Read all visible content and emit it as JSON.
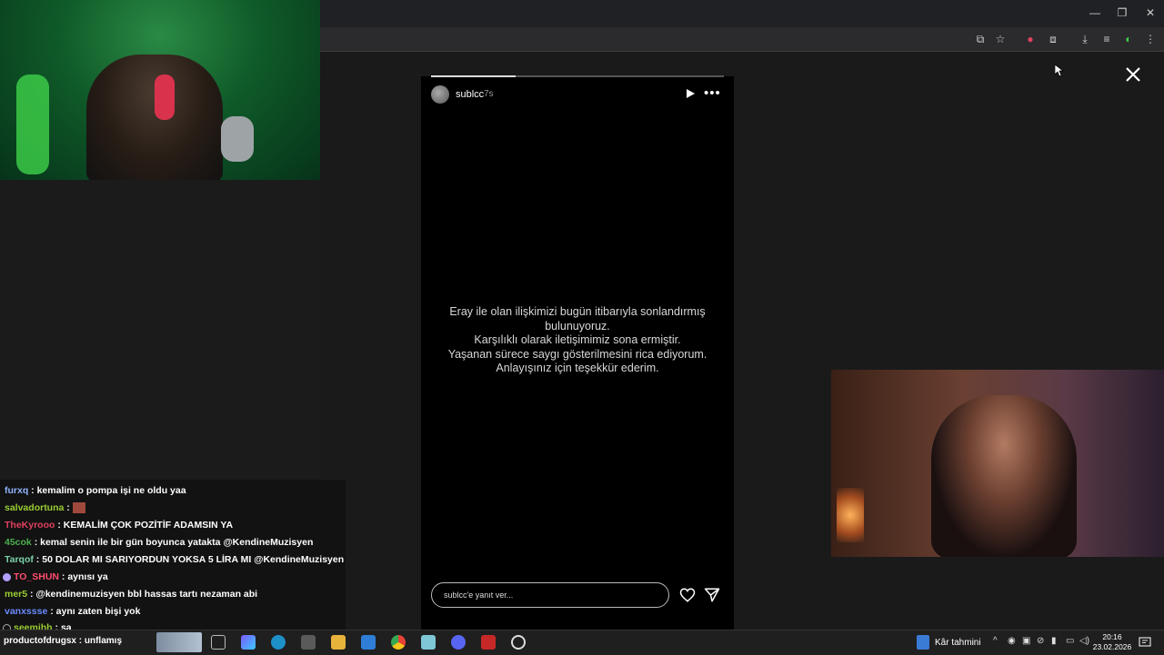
{
  "story": {
    "username": "sublcc",
    "time": "7s",
    "progress": 0.29,
    "lines": [
      "Eray ile olan ilişkimizi bugün itibarıyla sonlandırmış",
      "bulunuyoruz.",
      "Karşılıklı olarak iletişimimiz sona ermiştir.",
      "Yaşanan sürece saygı gösterilmesini rica ediyorum.",
      "Anlayışınız için teşekkür ederim."
    ],
    "reply_placeholder": "sublcc'e yanıt ver..."
  },
  "chat": [
    {
      "user": "furxq",
      "user_color": "#8fb3ff",
      "message": "kemalim o pompa işi ne oldu yaa"
    },
    {
      "user": "salvadortuna",
      "user_color": "#9acd32",
      "message": "",
      "emote": true
    },
    {
      "user": "TheKyrooo",
      "user_color": "#e0405e",
      "message": "KEMALİM ÇOK POZİTİF ADAMSIN YA"
    },
    {
      "user": "45cok",
      "user_color": "#4caf50",
      "message": "kemal senin ile bir gün boyunca yatakta @KendineMuzisyen"
    },
    {
      "user": "Tarqof",
      "user_color": "#7bd3a8",
      "message": "50 DOLAR MI SARIYORDUN YOKSA 5 LİRA MI @KendineMuzisyen"
    },
    {
      "user": "TO_SHUN",
      "user_color": "#ff4d6d",
      "message": "aynısı ya",
      "badge": true
    },
    {
      "user": "mer5",
      "user_color": "#9acd32",
      "message": "@kendinemuzisyen bbl hassas tartı nezaman abi"
    },
    {
      "user": "vanxssse",
      "user_color": "#6a8cff",
      "message": "aynı zaten bişi yok"
    },
    {
      "user": "seemihh",
      "user_color": "#9acd32",
      "message": "sa",
      "badge2": true
    }
  ],
  "taskbar": {
    "ticker": "productofdrugsx : unflamış",
    "weather_label": "Kâr tahmini",
    "clock_time": "20:16",
    "clock_date": "23.02.2026"
  },
  "colors": {
    "story_bg": "#000000",
    "page_bg": "#1a1a1a",
    "cam1_green": "#0f5a28"
  }
}
